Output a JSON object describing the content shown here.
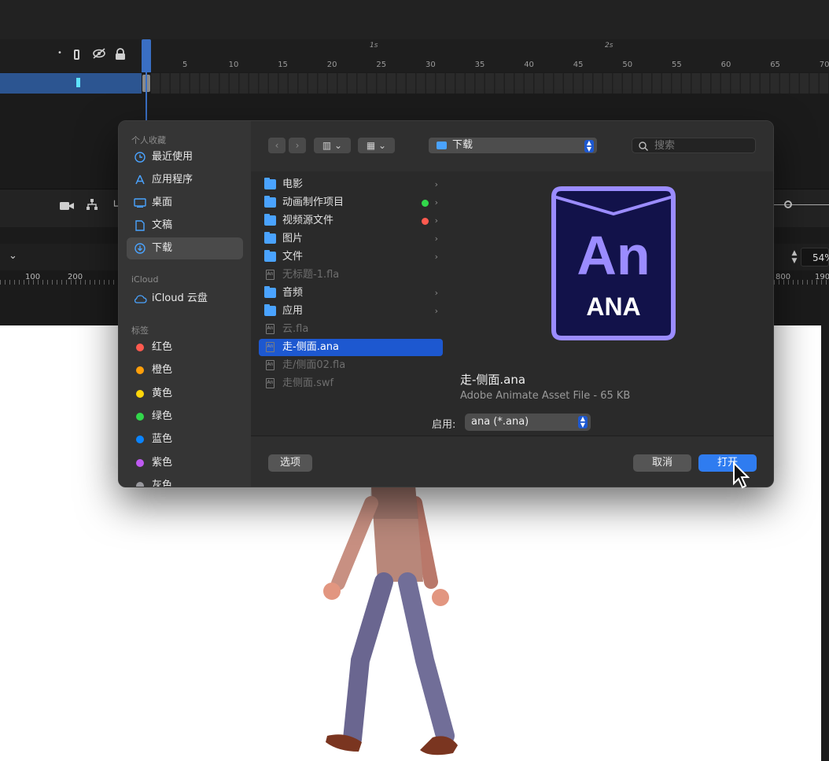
{
  "timeline": {
    "sec_labels": [
      "1s",
      "2s"
    ],
    "frame_numbers": [
      "5",
      "10",
      "15",
      "20",
      "25",
      "30",
      "35",
      "40",
      "45",
      "50",
      "55",
      "60",
      "65",
      "70"
    ],
    "layer_icons": [
      "dot-icon",
      "outline-icon",
      "eye-off-icon",
      "lock-icon"
    ]
  },
  "stage": {
    "ruler_numbers": [
      "100",
      "200",
      "800",
      "190"
    ],
    "zoom_value": "54%"
  },
  "dialog": {
    "sidebar": {
      "favorites_header": "个人收藏",
      "favorites": [
        {
          "label": "最近使用",
          "icon": "clock-icon"
        },
        {
          "label": "应用程序",
          "icon": "apps-icon"
        },
        {
          "label": "桌面",
          "icon": "desktop-icon"
        },
        {
          "label": "文稿",
          "icon": "document-icon"
        },
        {
          "label": "下载",
          "icon": "download-icon",
          "selected": true
        }
      ],
      "icloud_header": "iCloud",
      "icloud_items": [
        {
          "label": "iCloud 云盘",
          "icon": "cloud-icon"
        }
      ],
      "tags_header": "标签",
      "tags": [
        {
          "label": "红色",
          "color": "#ff5a4f"
        },
        {
          "label": "橙色",
          "color": "#ff9f0a"
        },
        {
          "label": "黄色",
          "color": "#ffd60a"
        },
        {
          "label": "绿色",
          "color": "#32d74b"
        },
        {
          "label": "蓝色",
          "color": "#0a84ff"
        },
        {
          "label": "紫色",
          "color": "#bf5af2"
        },
        {
          "label": "灰色",
          "color": "#98989d"
        }
      ]
    },
    "toolbar": {
      "back": "‹",
      "forward": "›",
      "view_columns": "▥ ⌄",
      "view_grid": "▦ ⌄",
      "path": "下载",
      "search_placeholder": "搜索"
    },
    "files": [
      {
        "name": "电影",
        "type": "folder",
        "chevron": true
      },
      {
        "name": "动画制作项目",
        "type": "folder",
        "chevron": true,
        "tag": "#32d74b"
      },
      {
        "name": "视频源文件",
        "type": "folder",
        "chevron": true,
        "tag": "#ff5a4f"
      },
      {
        "name": "图片",
        "type": "folder",
        "chevron": true
      },
      {
        "name": "文件",
        "type": "folder",
        "chevron": true
      },
      {
        "name": "无标题-1.fla",
        "type": "doc",
        "dim": true
      },
      {
        "name": "音频",
        "type": "folder",
        "chevron": true
      },
      {
        "name": "应用",
        "type": "folder",
        "chevron": true
      },
      {
        "name": "云.fla",
        "type": "doc",
        "dim": true
      },
      {
        "name": "走-侧面.ana",
        "type": "doc",
        "selected": true
      },
      {
        "name": "走/侧面02.fla",
        "type": "doc",
        "dim": true
      },
      {
        "name": "走侧面.swf",
        "type": "doc",
        "dim": true
      }
    ],
    "preview": {
      "icon_big": "An",
      "icon_small": "ANA",
      "name": "走-侧面.ana",
      "meta": "Adobe Animate Asset File - 65 KB"
    },
    "enable_label": "启用:",
    "enable_value": "ana (*.ana)",
    "options_button": "选项",
    "cancel_button": "取消",
    "open_button": "打开"
  },
  "colors": {
    "accent": "#1d58d0",
    "open_button": "#2f7cf0",
    "ana_icon_bg": "#12124a",
    "ana_icon_fg": "#9b8cff"
  }
}
